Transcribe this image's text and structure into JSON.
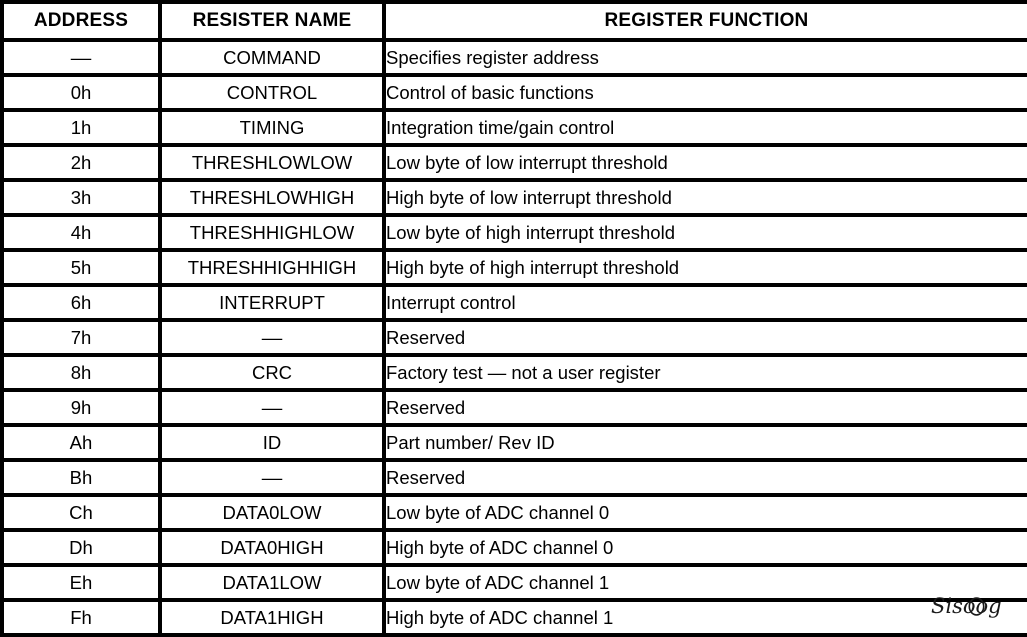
{
  "table": {
    "headers": {
      "address": "ADDRESS",
      "name": "RESISTER NAME",
      "function": "REGISTER FUNCTION"
    },
    "rows": [
      {
        "address": "––",
        "name": "COMMAND",
        "function": "Specifies register address"
      },
      {
        "address": "0h",
        "name": "CONTROL",
        "function": "Control of basic functions"
      },
      {
        "address": "1h",
        "name": "TIMING",
        "function": "Integration time/gain control"
      },
      {
        "address": "2h",
        "name": "THRESHLOWLOW",
        "function": "Low byte of low interrupt threshold"
      },
      {
        "address": "3h",
        "name": "THRESHLOWHIGH",
        "function": "High byte of low interrupt threshold"
      },
      {
        "address": "4h",
        "name": "THRESHHIGHLOW",
        "function": "Low byte of high interrupt threshold"
      },
      {
        "address": "5h",
        "name": "THRESHHIGHHIGH",
        "function": "High byte of high interrupt threshold"
      },
      {
        "address": "6h",
        "name": "INTERRUPT",
        "function": "Interrupt control"
      },
      {
        "address": "7h",
        "name": "––",
        "function": "Reserved"
      },
      {
        "address": "8h",
        "name": "CRC",
        "function": "Factory test — not a user register"
      },
      {
        "address": "9h",
        "name": "––",
        "function": "Reserved"
      },
      {
        "address": "Ah",
        "name": "ID",
        "function": "Part number/ Rev ID"
      },
      {
        "address": "Bh",
        "name": "––",
        "function": "Reserved"
      },
      {
        "address": "Ch",
        "name": "DATA0LOW",
        "function": "Low byte of ADC channel 0"
      },
      {
        "address": "Dh",
        "name": "DATA0HIGH",
        "function": "High byte of ADC channel 0"
      },
      {
        "address": "Eh",
        "name": "DATA1LOW",
        "function": "Low byte of ADC channel 1"
      },
      {
        "address": "Fh",
        "name": "DATA1HIGH",
        "function": "High byte of ADC channel 1"
      }
    ]
  },
  "watermark": {
    "text": "Sisoog"
  },
  "colors": {
    "border": "#000000",
    "text": "#000000",
    "background": "#ffffff",
    "watermark": "#1a1a1a"
  }
}
